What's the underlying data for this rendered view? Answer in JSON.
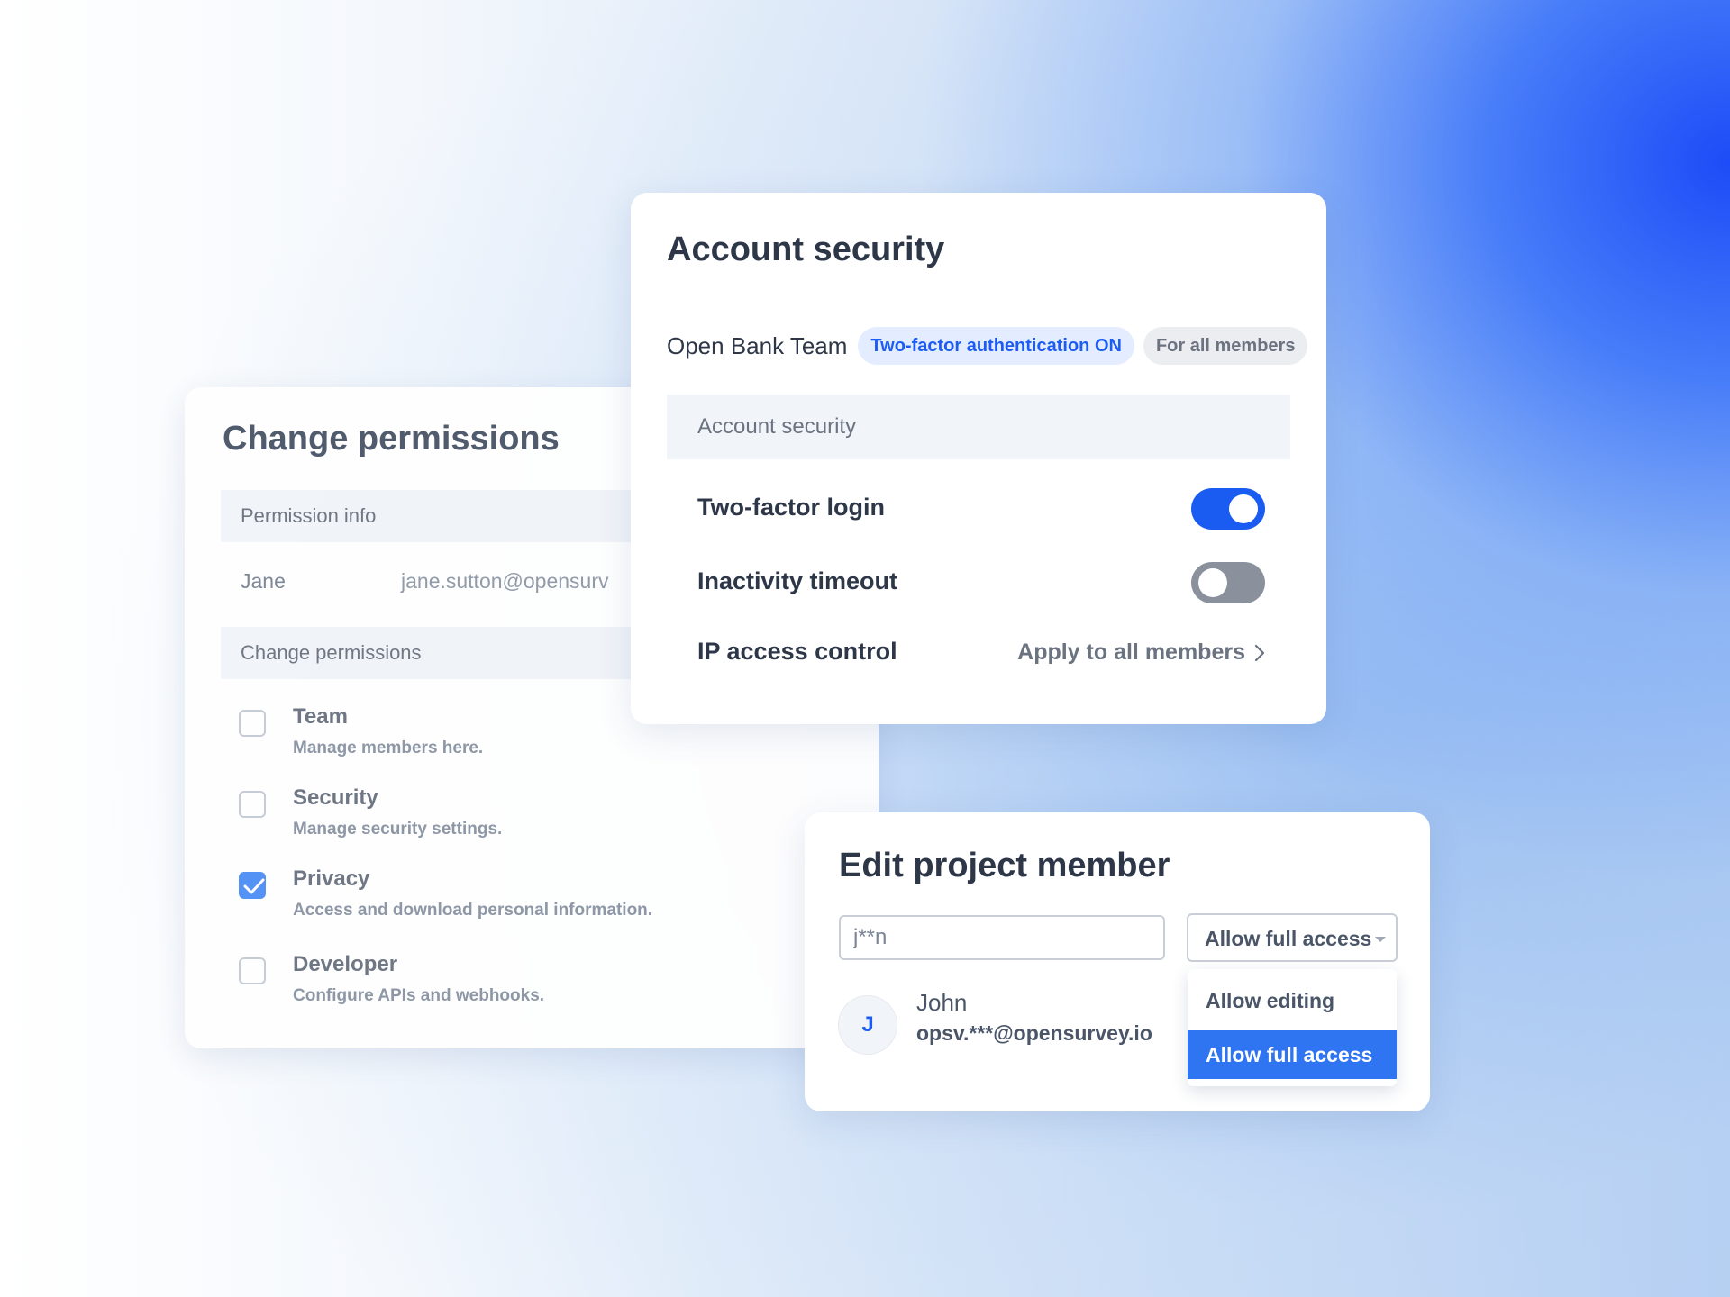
{
  "change_permissions": {
    "title": "Change permissions",
    "info_section": "Permission info",
    "user_name": "Jane",
    "user_email": "jane.sutton@opensurv",
    "permissions_section": "Change permissions",
    "items": [
      {
        "name": "Team",
        "description": "Manage members here.",
        "checked": false
      },
      {
        "name": "Security",
        "description": "Manage security settings.",
        "checked": false
      },
      {
        "name": "Privacy",
        "description": "Access and download personal information.",
        "checked": true
      },
      {
        "name": "Developer",
        "description": "Configure APIs and webhooks.",
        "checked": false
      }
    ]
  },
  "account_security": {
    "title": "Account security",
    "team_name": "Open Bank Team",
    "badge_2fa": "Two-factor authentication ON",
    "badge_scope": "For all members",
    "section_label": "Account security",
    "two_factor_label": "Two-factor login",
    "two_factor_on": true,
    "inactivity_label": "Inactivity timeout",
    "inactivity_on": false,
    "ip_label": "IP access control",
    "ip_link": "Apply to all members"
  },
  "edit_member": {
    "title": "Edit project member",
    "search_value": "j**n",
    "access_selected": "Allow full access",
    "options": [
      "Allow editing",
      "Allow full access"
    ],
    "member_initial": "J",
    "member_name": "John",
    "member_email": "opsv.***@opensurvey.io"
  },
  "colors": {
    "accent": "#1a5cf2",
    "toggle_off": "#8a919d",
    "checkbox_checked": "#4f8ef5"
  }
}
